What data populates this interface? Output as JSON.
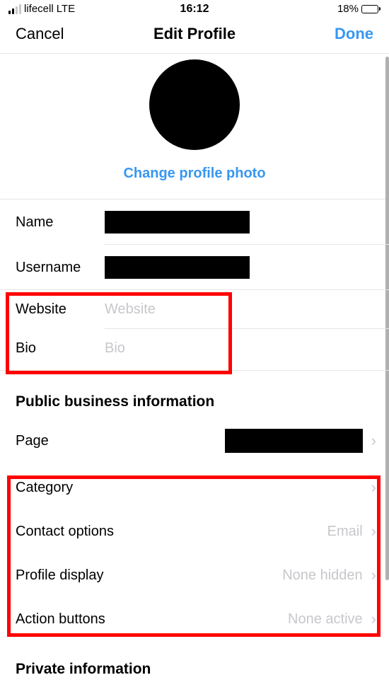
{
  "status": {
    "carrier": "lifecell",
    "network": "LTE",
    "time": "16:12",
    "battery_pct": "18%"
  },
  "nav": {
    "left": "Cancel",
    "title": "Edit Profile",
    "right": "Done"
  },
  "avatar": {
    "change_label": "Change profile photo"
  },
  "fields": {
    "name_label": "Name",
    "username_label": "Username",
    "website_label": "Website",
    "website_placeholder": "Website",
    "bio_label": "Bio",
    "bio_placeholder": "Bio"
  },
  "business": {
    "header": "Public business information",
    "page_label": "Page",
    "category_label": "Category",
    "category_value": "",
    "contact_label": "Contact options",
    "contact_value": "Email",
    "display_label": "Profile display",
    "display_value": "None hidden",
    "actions_label": "Action buttons",
    "actions_value": "None active"
  },
  "private": {
    "header": "Private information"
  }
}
